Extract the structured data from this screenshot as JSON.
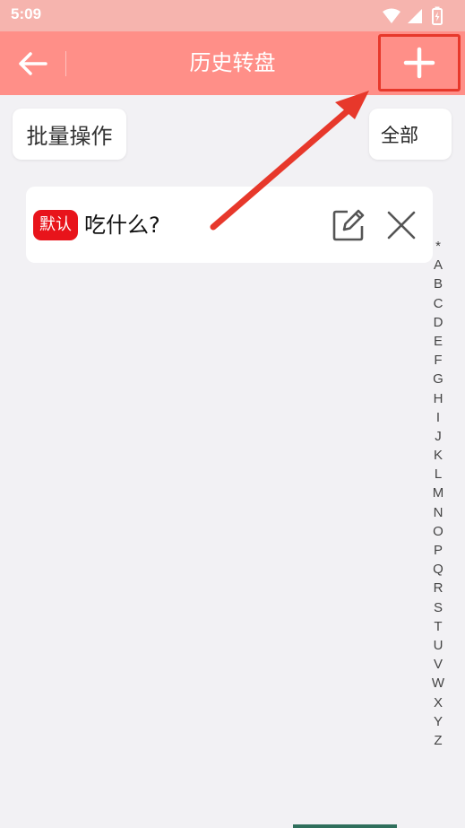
{
  "status_bar": {
    "time": "5:09",
    "icons": [
      "wifi-icon",
      "cellular-icon",
      "battery-icon"
    ]
  },
  "app_bar": {
    "title": "历史转盘",
    "back_icon": "arrow-left-icon",
    "add_icon": "plus-icon"
  },
  "toolbar": {
    "batch_label": "批量操作",
    "filter_label": "全部"
  },
  "wheels": [
    {
      "badge": "默认",
      "name": "吃什么?",
      "edit_icon": "edit-icon",
      "delete_icon": "close-icon"
    }
  ],
  "alpha_index": [
    "*",
    "A",
    "B",
    "C",
    "D",
    "E",
    "F",
    "G",
    "H",
    "I",
    "J",
    "K",
    "L",
    "M",
    "N",
    "O",
    "P",
    "Q",
    "R",
    "S",
    "T",
    "U",
    "V",
    "W",
    "X",
    "Y",
    "Z"
  ],
  "colors": {
    "app_bar": "#ff8f88",
    "status_bar": "#f6b4ae",
    "badge": "#e8141b",
    "annotation": "#e7382b",
    "background": "#f2f1f4"
  }
}
